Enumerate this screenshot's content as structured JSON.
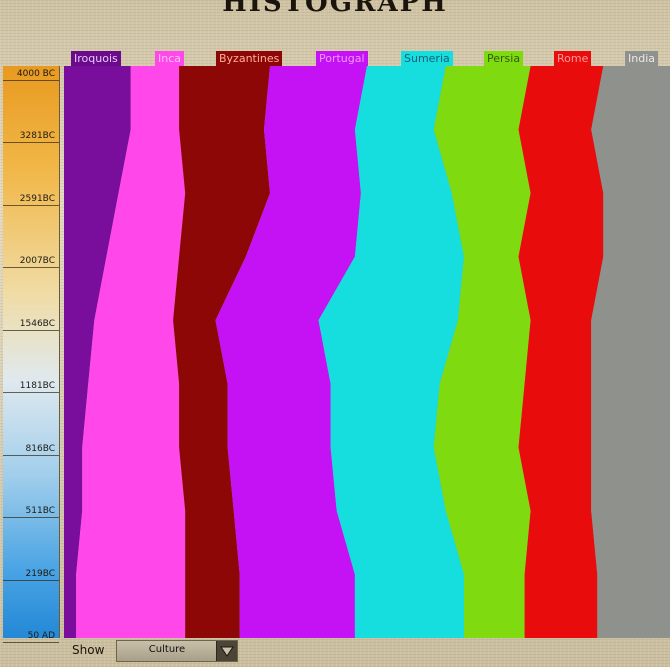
{
  "title": "HISTOGRAPH",
  "timeline": {
    "ticks": [
      "4000 BC",
      "3281BC",
      "2591BC",
      "2007BC",
      "1546BC",
      "1181BC",
      "816BC",
      "511BC",
      "219BC",
      "50 AD"
    ]
  },
  "chart_data": {
    "type": "area",
    "title": "HISTOGRAPH",
    "y_axis_ticks": [
      "4000 BC",
      "3281BC",
      "2591BC",
      "2007BC",
      "1546BC",
      "1181BC",
      "816BC",
      "511BC",
      "219BC",
      "50 AD"
    ],
    "series": [
      {
        "name": "Iroquois",
        "color": "#7a0e9c",
        "width": [
          0.11,
          0.11,
          0.09,
          0.07,
          0.05,
          0.04,
          0.03,
          0.03,
          0.02,
          0.02
        ]
      },
      {
        "name": "Inca",
        "color": "#ff47ea",
        "width": [
          0.08,
          0.08,
          0.11,
          0.12,
          0.13,
          0.15,
          0.16,
          0.17,
          0.18,
          0.18
        ]
      },
      {
        "name": "Byzantines",
        "color": "#8e0707",
        "width": [
          0.15,
          0.14,
          0.14,
          0.11,
          0.07,
          0.08,
          0.08,
          0.08,
          0.09,
          0.09
        ]
      },
      {
        "name": "Portugal",
        "color": "#c412f5",
        "width": [
          0.16,
          0.15,
          0.15,
          0.18,
          0.17,
          0.17,
          0.17,
          0.17,
          0.19,
          0.19
        ]
      },
      {
        "name": "Sumeria",
        "color": "#17dede",
        "width": [
          0.13,
          0.13,
          0.15,
          0.18,
          0.23,
          0.18,
          0.17,
          0.18,
          0.18,
          0.18
        ]
      },
      {
        "name": "Persia",
        "color": "#7fdb10",
        "width": [
          0.14,
          0.14,
          0.13,
          0.09,
          0.12,
          0.14,
          0.14,
          0.14,
          0.1,
          0.1
        ]
      },
      {
        "name": "Rome",
        "color": "#e80c0c",
        "width": [
          0.12,
          0.12,
          0.12,
          0.14,
          0.1,
          0.11,
          0.12,
          0.1,
          0.12,
          0.12
        ]
      },
      {
        "name": "India",
        "color": "#8e918c",
        "width": [
          0.11,
          0.13,
          0.11,
          0.11,
          0.13,
          0.13,
          0.13,
          0.13,
          0.12,
          0.12
        ]
      }
    ]
  },
  "legend": [
    {
      "name": "Iroquois",
      "bg": "#6a0b8a",
      "fg": "#e8c8ff"
    },
    {
      "name": "Inca",
      "bg": "#ff47ea",
      "fg": "#ffc0f6"
    },
    {
      "name": "Byzantines",
      "bg": "#8e0707",
      "fg": "#ffb0a0"
    },
    {
      "name": "Portugal",
      "bg": "#c412f5",
      "fg": "#ee99ff"
    },
    {
      "name": "Sumeria",
      "bg": "#17dede",
      "fg": "#1a5e78"
    },
    {
      "name": "Persia",
      "bg": "#7fdb10",
      "fg": "#2e5e08"
    },
    {
      "name": "Rome",
      "bg": "#e80c0c",
      "fg": "#ff9a9a"
    },
    {
      "name": "India",
      "bg": "#8e918c",
      "fg": "#e8e8e8"
    }
  ],
  "controls": {
    "show_label": "Show",
    "dropdown_value": "Culture",
    "arrow_icon": "triangle-down-icon"
  }
}
